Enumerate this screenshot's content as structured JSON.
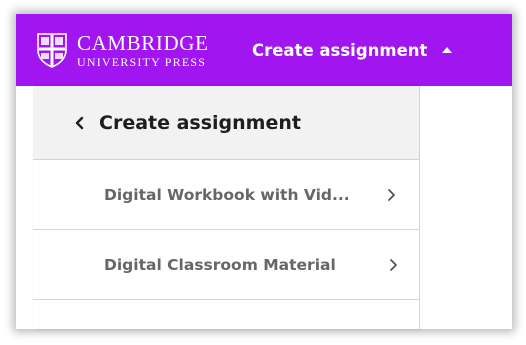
{
  "header": {
    "logo": {
      "main": "CAMBRIDGE",
      "sub": "UNIVERSITY PRESS",
      "icon": "cambridge-shield-icon"
    },
    "dropdown_label": "Create assignment",
    "dropdown_icon": "caret-up-icon"
  },
  "menu": {
    "title": "Create assignment",
    "back_icon": "chevron-left-icon",
    "items": [
      {
        "label": "Digital Workbook with Vid...",
        "icon": "chevron-right-icon"
      },
      {
        "label": "Digital Classroom Material",
        "icon": "chevron-right-icon"
      }
    ]
  },
  "colors": {
    "header_bg": "#a115f0",
    "header_text": "#ffffff",
    "menu_header_bg": "#f2f2f2",
    "menu_item_text": "#666666",
    "title_text": "#1e1e1e"
  }
}
